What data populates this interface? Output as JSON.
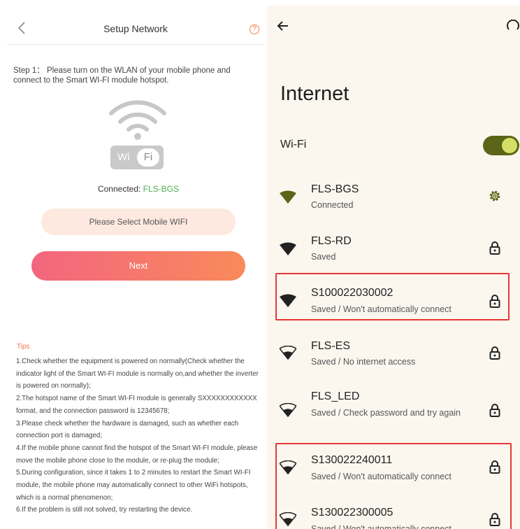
{
  "left": {
    "header_title": "Setup Network",
    "help_glyph": "?",
    "step_text": "Step 1：  Please turn on the WLAN of your mobile phone and connect to the Smart WI-FI module hotspot.",
    "wifi_badge": {
      "left": "Wi",
      "right": "Fi"
    },
    "connected_label": "Connected: ",
    "connected_ssid": "FLS-BGS",
    "select_button": "Please Select Mobile WIFI",
    "next_button": "Next",
    "tips_heading": "Tips",
    "tips": [
      "1.Check whether the equipment is powered on normally(Check whether the indicator light of the Smart WI-FI module is normally on,and whether the inverter is powered on normally);",
      "2.The hotspot name of the Smart WI-FI module is generally SXXXXXXXXXXXX format, and the connection password is 12345678;",
      "3.Please check whether the hardware is damaged, such as whether each connection port is damaged;",
      "4.If the mobile phone cannot find the hotspot of the Smart WI-FI module, please move the mobile phone close to the module, or re-plug the module;",
      "5.During configuration, since it takes 1 to 2 minutes to restart the Smart WI-FI module, the mobile phone may automatically connect to other WiFi hotspots, which is a normal phenomenon;",
      "6.If the problem is still not solved, try restarting the device."
    ],
    "colors": {
      "accent": "#f07a4a",
      "connected": "#4caf50",
      "next_start": "#f3657f",
      "next_end": "#f98a5a"
    }
  },
  "right": {
    "title": "Internet",
    "wifi_label": "Wi-Fi",
    "wifi_enabled": true,
    "networks": [
      {
        "name": "FLS-BGS",
        "status": "Connected",
        "action_icon": "gear-icon",
        "active": true,
        "highlighted": false
      },
      {
        "name": "FLS-RD",
        "status": "Saved",
        "action_icon": "lock-icon",
        "active": false,
        "highlighted": false
      },
      {
        "name": "S100022030002",
        "status": "Saved / Won't automatically connect",
        "action_icon": "lock-icon",
        "active": false,
        "highlighted": true
      },
      {
        "name": "FLS-ES",
        "status": "Saved / No internet access",
        "action_icon": "lock-icon",
        "active": false,
        "highlighted": false
      },
      {
        "name": "FLS_LED",
        "status": "Saved / Check password and try again",
        "action_icon": "lock-icon",
        "active": false,
        "highlighted": false
      },
      {
        "name": "S130022240011",
        "status": "Saved / Won't automatically connect",
        "action_icon": "lock-icon",
        "active": false,
        "highlighted": true
      },
      {
        "name": "S130022300005",
        "status": "Saved / Won't automatically connect",
        "action_icon": "lock-icon",
        "active": false,
        "highlighted": true
      }
    ],
    "colors": {
      "background": "#fbf7ef",
      "toggle_track": "#5a6517",
      "toggle_knob": "#d3df67",
      "active_signal": "#5a6517",
      "highlight": "#e53935"
    }
  }
}
